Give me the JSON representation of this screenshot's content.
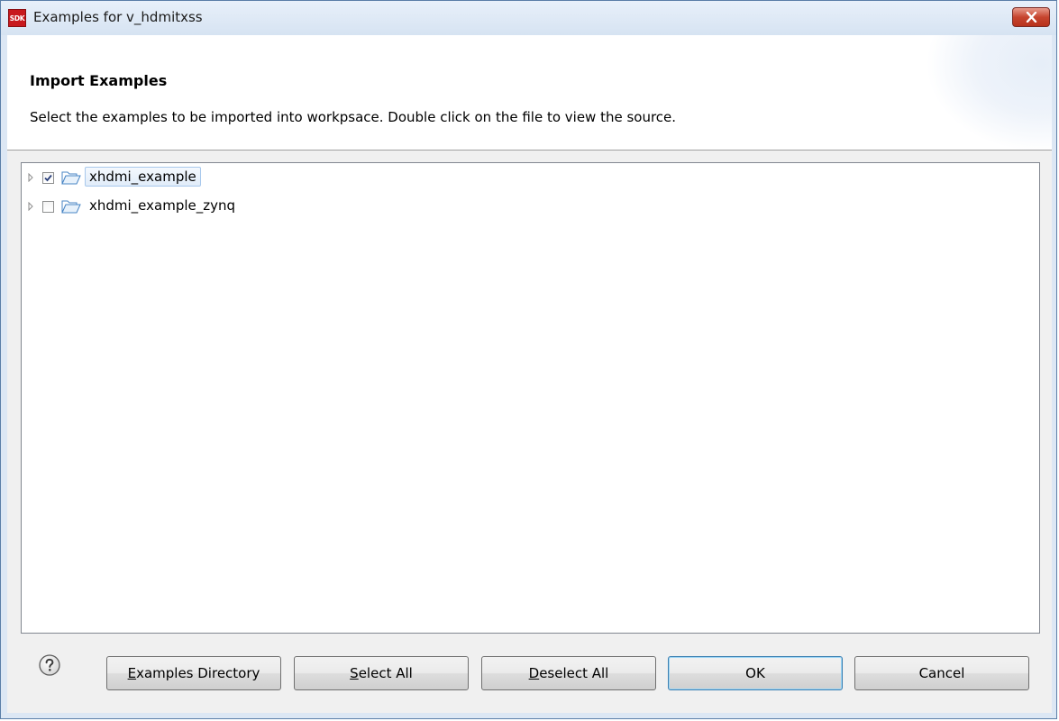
{
  "window": {
    "title": "Examples for v_hdmitxss",
    "app_icon_text": "SDK"
  },
  "header": {
    "title": "Import Examples",
    "description": "Select the examples to be imported into workpsace. Double click on the file to view the source."
  },
  "tree": {
    "items": [
      {
        "label": "xhdmi_example",
        "checked": true,
        "selected": true,
        "icon": "folder-open-icon",
        "expander": "collapsed"
      },
      {
        "label": "xhdmi_example_zynq",
        "checked": false,
        "selected": false,
        "icon": "folder-open-icon",
        "expander": "collapsed"
      }
    ]
  },
  "buttons": {
    "examples_directory": {
      "mnemonic": "E",
      "rest": "xamples Directory"
    },
    "select_all": {
      "mnemonic": "S",
      "rest": "elect All"
    },
    "deselect_all": {
      "mnemonic": "D",
      "rest": "eselect All"
    },
    "ok": "OK",
    "cancel": "Cancel"
  },
  "icons": {
    "help": "help-icon",
    "close": "close-icon"
  },
  "colors": {
    "close_button": "#c6452f",
    "app_icon": "#c8191e",
    "selection_border": "#a8c8ec",
    "default_button_border": "#3c7fb1"
  }
}
